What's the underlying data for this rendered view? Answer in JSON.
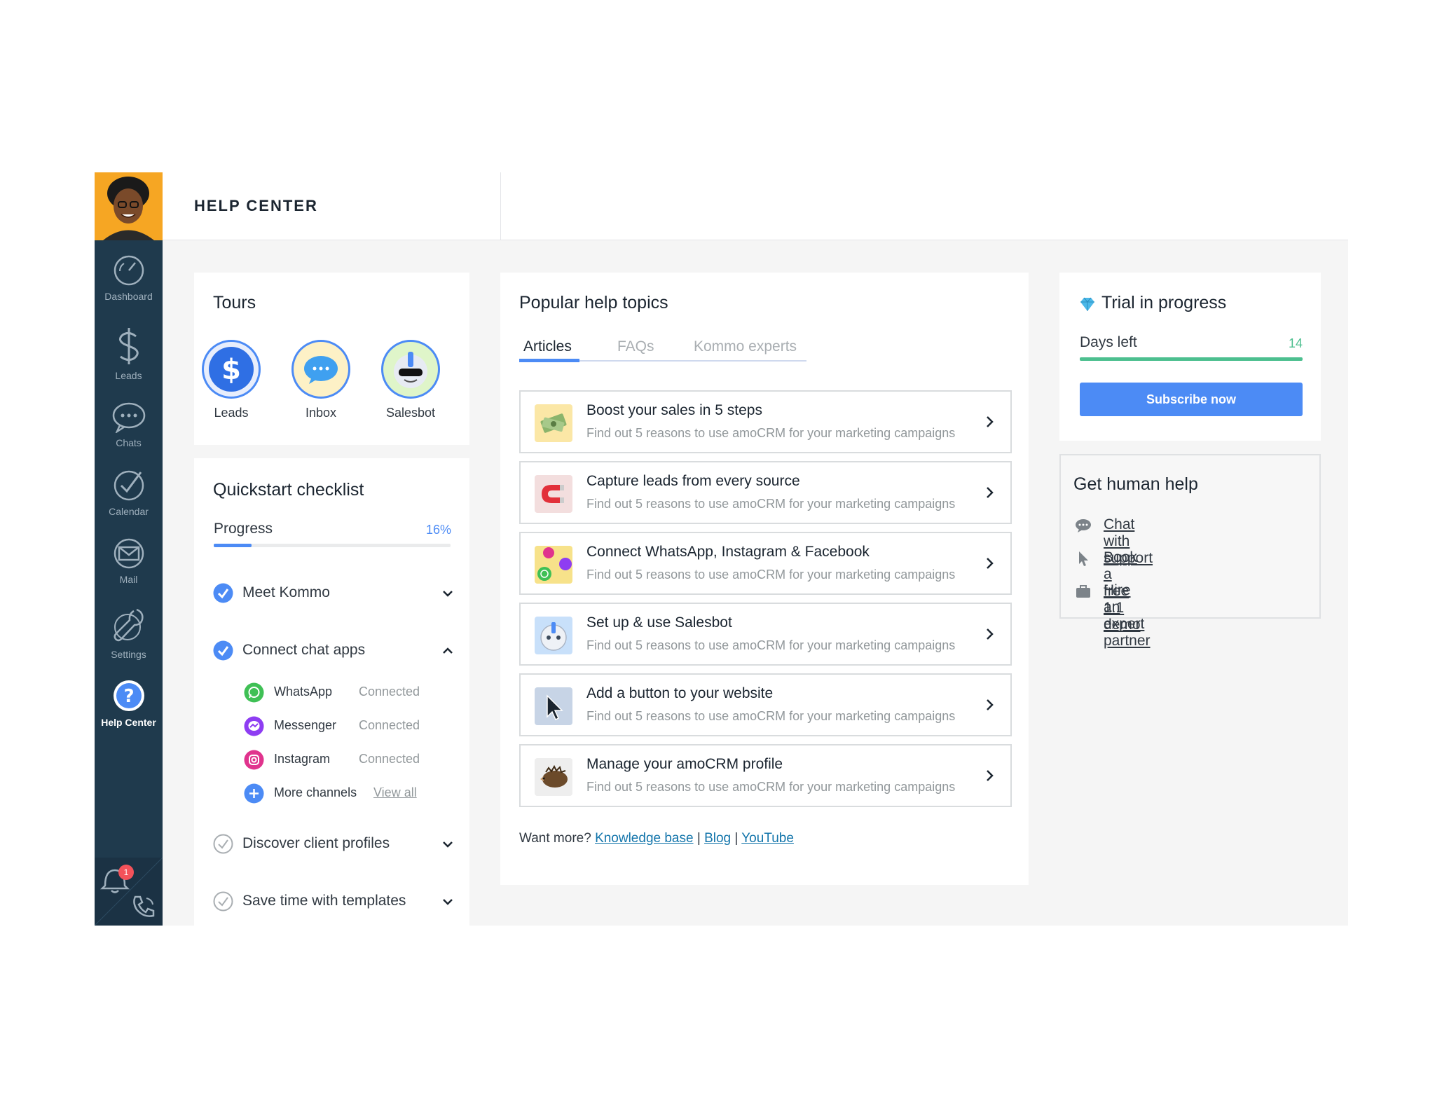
{
  "sidebar": {
    "items": [
      {
        "label": "Dashboard",
        "icon": "dashboard-icon"
      },
      {
        "label": "Leads",
        "icon": "dollar-icon"
      },
      {
        "label": "Chats",
        "icon": "chat-bubble-icon"
      },
      {
        "label": "Calendar",
        "icon": "checkmark-icon"
      },
      {
        "label": "Mail",
        "icon": "mail-icon"
      },
      {
        "label": "Settings",
        "icon": "wrench-icon"
      },
      {
        "label": "Help Center",
        "icon": "question-icon",
        "active": true
      }
    ],
    "notifications_count": "1"
  },
  "header": {
    "title": "HELP CENTER"
  },
  "tours": {
    "title": "Tours",
    "items": [
      {
        "label": "Leads",
        "icon": "dollar-badge-icon"
      },
      {
        "label": "Inbox",
        "icon": "chat-badge-icon"
      },
      {
        "label": "Salesbot",
        "icon": "robot-badge-icon"
      }
    ]
  },
  "checklist": {
    "title": "Quickstart checklist",
    "progress_label": "Progress",
    "progress_value": "16%",
    "progress_fraction": 0.16,
    "items": [
      {
        "label": "Meet Kommo",
        "done": true,
        "expanded": false
      },
      {
        "label": "Connect chat apps",
        "done": true,
        "expanded": true
      },
      {
        "label": "Discover client profiles",
        "done": false,
        "expanded": false
      },
      {
        "label": "Save time with templates",
        "done": false,
        "expanded": false
      }
    ],
    "channels": [
      {
        "name": "WhatsApp",
        "status": "Connected",
        "icon": "whatsapp-icon"
      },
      {
        "name": "Messenger",
        "status": "Connected",
        "icon": "messenger-icon"
      },
      {
        "name": "Instagram",
        "status": "Connected",
        "icon": "instagram-icon"
      },
      {
        "name": "More channels",
        "status": "View all",
        "icon": "plus-icon"
      }
    ]
  },
  "topics": {
    "title": "Popular help topics",
    "tabs": [
      "Articles",
      "FAQs",
      "Kommo experts"
    ],
    "active_tab": "Articles",
    "items": [
      {
        "title": "Boost your sales in 5 steps",
        "subtitle": "Find out 5 reasons to use amoCRM for your marketing campaigns",
        "icon": "money-icon"
      },
      {
        "title": "Capture leads from every source",
        "subtitle": "Find out 5 reasons to use amoCRM for your marketing campaigns",
        "icon": "magnet-icon"
      },
      {
        "title": "Connect WhatsApp, Instagram & Facebook",
        "subtitle": "Find out 5 reasons to use amoCRM for your marketing campaigns",
        "icon": "messengers-icon"
      },
      {
        "title": "Set up & use Salesbot",
        "subtitle": "Find out 5 reasons to use amoCRM for your marketing campaigns",
        "icon": "robot-icon"
      },
      {
        "title": "Add a button to your website",
        "subtitle": "Find out 5 reasons to use amoCRM for your marketing campaigns",
        "icon": "cursor-icon"
      },
      {
        "title": "Manage your amoCRM profile",
        "subtitle": "Find out 5 reasons to use amoCRM for your marketing campaigns",
        "icon": "hedgehog-icon"
      }
    ],
    "more_prefix": "Want more?",
    "more_links": [
      "Knowledge base",
      "Blog",
      "YouTube"
    ],
    "separator": "|"
  },
  "trial": {
    "title": "Trial in progress",
    "days_label": "Days left",
    "days_value": "14",
    "days_fraction": 1.0,
    "button": "Subscribe now",
    "accent": "#4c8bf5",
    "bar_color": "#4cbf8f"
  },
  "human_help": {
    "title": "Get human help",
    "items": [
      {
        "label": "Chat with support",
        "icon": "chat-icon"
      },
      {
        "label": "Book a free 1:1 demo",
        "icon": "pointer-icon"
      },
      {
        "label": "Hire an expert partner",
        "icon": "briefcase-icon"
      }
    ]
  }
}
